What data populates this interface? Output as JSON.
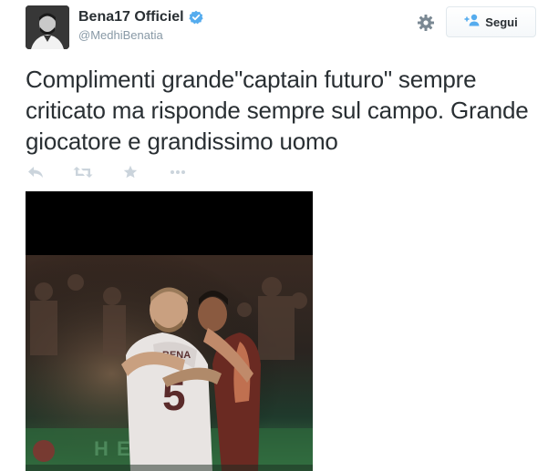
{
  "tweet": {
    "author": {
      "display_name": "Bena17 Officiel",
      "handle": "@MedhiBenatia",
      "verified": true
    },
    "follow_label": "Segui",
    "text": "Complimenti grande\"captain futuro\" sempre criticato ma risponde sempre sul campo. Grande giocatore e grandissimo uomo",
    "actions": [
      "reply-icon",
      "retweet-icon",
      "favorite-icon",
      "more-icon"
    ],
    "media": {
      "jersey_number": "5",
      "jersey_name": "BENA"
    }
  },
  "colors": {
    "text": "#292f33",
    "muted": "#8899a6",
    "verified": "#55acee",
    "action_icons": "#cbd4dc"
  }
}
